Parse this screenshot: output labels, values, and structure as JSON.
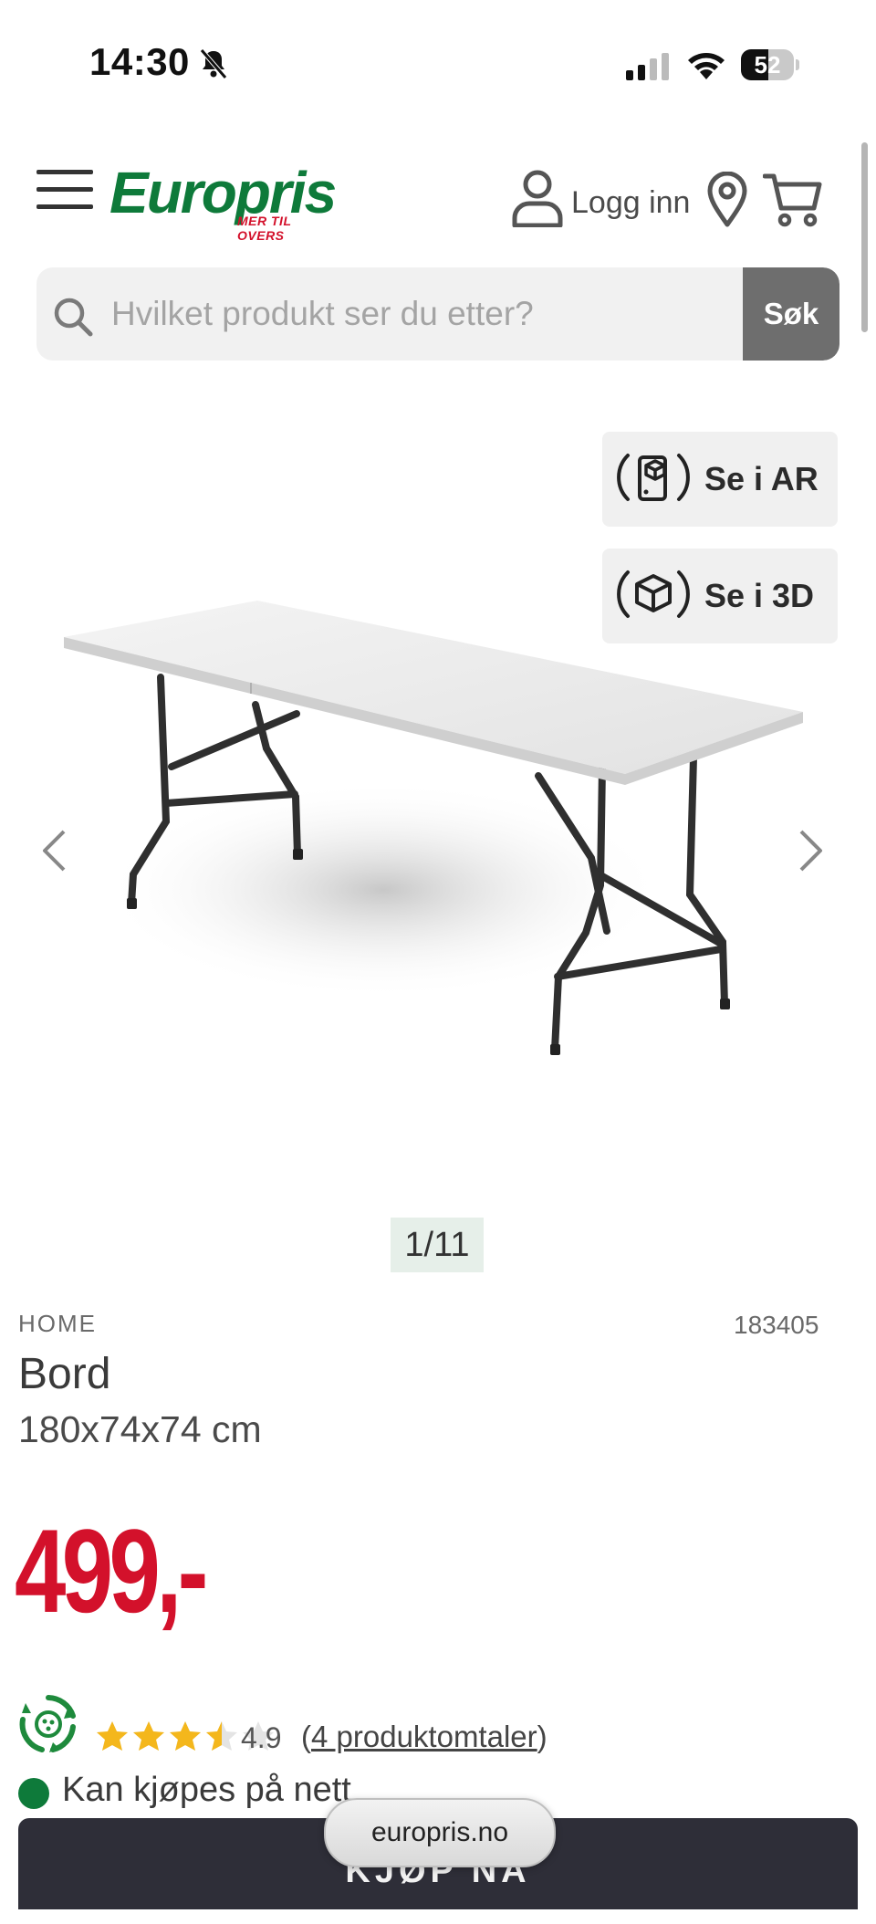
{
  "status_bar": {
    "time": "14:30",
    "battery": "52",
    "battery_level": 0.52
  },
  "header": {
    "logo": {
      "name": "Europris",
      "tagline": "MER TIL OVERS"
    },
    "login_label": "Logg inn"
  },
  "search": {
    "placeholder": "Hvilket produkt ser du etter?",
    "value": "",
    "button_label": "Søk"
  },
  "view_buttons": {
    "ar_label": "Se i AR",
    "three_d_label": "Se i 3D"
  },
  "gallery": {
    "counter": "1/11",
    "current": 1,
    "total": 11
  },
  "product": {
    "brand": "HOME",
    "sku": "183405",
    "title": "Bord",
    "size": "180x74x74 cm",
    "price": "499,-"
  },
  "rating": {
    "stars": 3.5,
    "value": "4.9",
    "reviews_paren_open": "(",
    "reviews_link": "4 produktomtaler",
    "reviews_paren_close": ")"
  },
  "stock": {
    "text": "Kan kjøpes på nett"
  },
  "buy_button": {
    "label": "KJØP NÅ"
  },
  "browser": {
    "url": "europris.no"
  },
  "colors": {
    "brand_green": "#0e7a3a",
    "price_red": "#d3112b",
    "buy_bar": "#2e2e38",
    "search_button": "#6e6e6e"
  }
}
